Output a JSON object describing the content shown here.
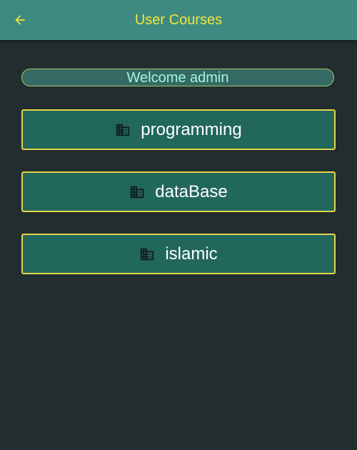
{
  "app_bar": {
    "title": "User Courses",
    "back_icon": "arrow-left-icon",
    "title_color": "#f4e53c",
    "background": "#3e8a80"
  },
  "welcome": {
    "text": "Welcome admin"
  },
  "courses": [
    {
      "label": "programming",
      "icon": "building-icon"
    },
    {
      "label": "dataBase",
      "icon": "building-icon"
    },
    {
      "label": "islamic",
      "icon": "building-icon"
    }
  ],
  "colors": {
    "page_background": "#222d2f",
    "button_background": "#22675c",
    "button_border": "#e5d44a",
    "welcome_text": "#a5f5dc"
  }
}
